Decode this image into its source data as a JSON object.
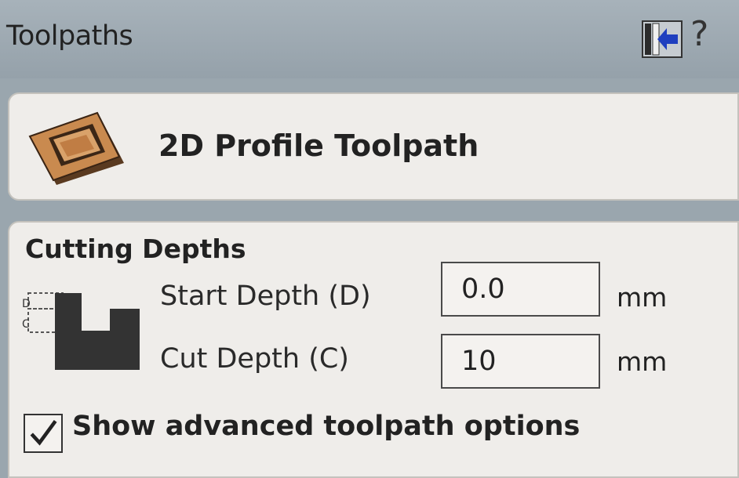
{
  "panel": {
    "title": "Toolpaths",
    "help_label": "?",
    "pin_icon": "pin-panel-icon"
  },
  "header": {
    "title": "2D Profile Toolpath",
    "icon": "profile-toolpath-icon"
  },
  "cutting_depths": {
    "title": "Cutting Depths",
    "diagram_labels": {
      "d": "D",
      "c": "C"
    },
    "start_depth": {
      "label": "Start Depth (D)",
      "value": "0.0",
      "unit": "mm"
    },
    "cut_depth": {
      "label": "Cut Depth (C)",
      "value": "10",
      "unit": "mm"
    }
  },
  "advanced": {
    "label": "Show advanced toolpath options",
    "checked": true
  },
  "colors": {
    "titlebar": "#9aa6ae",
    "panel_bg": "#efedea",
    "pin_blue": "#1f3fbf",
    "icon_orange": "#c98a4f"
  }
}
